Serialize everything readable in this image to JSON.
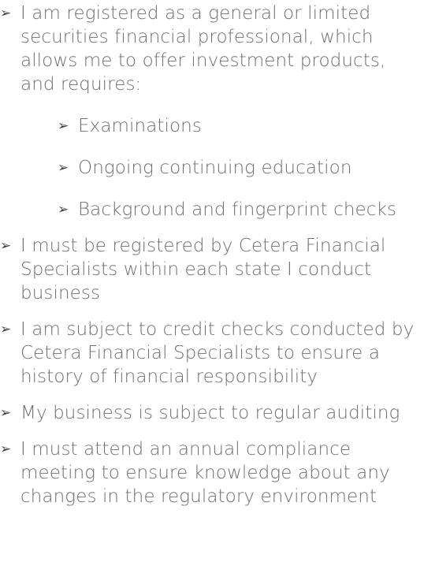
{
  "colors": {
    "text": "#6b6f74",
    "bullet": "#3d4043",
    "background": "#ffffff"
  },
  "bullet_icon": "filled-right-arrowhead-icon",
  "bullet_glyph": "➢",
  "items": [
    {
      "text": "I am registered as a general or limited securities financial professional, which allows me to offer investment products, and requires:",
      "subitems": [
        {
          "text": "Examinations"
        },
        {
          "text": "Ongoing continuing education"
        },
        {
          "text": "Background and fingerprint checks"
        }
      ]
    },
    {
      "text": "I must be registered by Cetera Financial Specialists within each state I conduct business"
    },
    {
      "text": "I am subject to credit checks conducted by Cetera Financial Specialists to ensure a history of financial responsibility"
    },
    {
      "text": "My business is subject to regular auditing"
    },
    {
      "text": "I must attend an annual compliance meeting to ensure knowledge about any changes in the regulatory environment"
    }
  ]
}
